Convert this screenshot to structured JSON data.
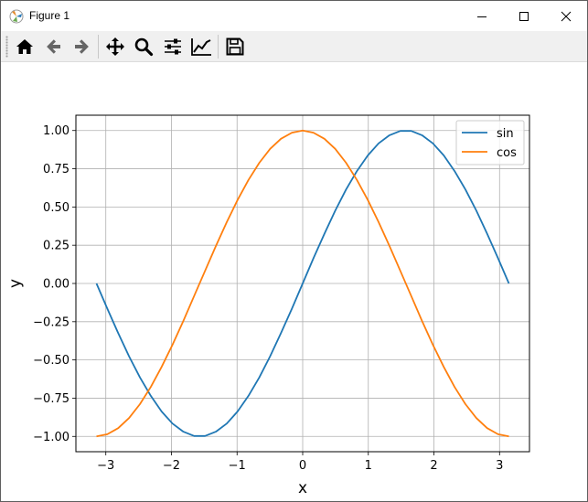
{
  "window": {
    "title": "Figure 1",
    "controls": [
      "minimize",
      "maximize",
      "close"
    ]
  },
  "toolbar": {
    "buttons": [
      {
        "name": "home",
        "icon": "home-icon"
      },
      {
        "name": "back",
        "icon": "arrow-left-icon"
      },
      {
        "name": "forward",
        "icon": "arrow-right-icon"
      },
      {
        "name": "pan",
        "icon": "move-icon"
      },
      {
        "name": "zoom",
        "icon": "magnifier-icon"
      },
      {
        "name": "configure-subplots",
        "icon": "sliders-icon"
      },
      {
        "name": "edit-axis",
        "icon": "line-chart-icon"
      },
      {
        "name": "save",
        "icon": "floppy-disk-icon"
      }
    ]
  },
  "chart_data": {
    "type": "line",
    "xlabel": "x",
    "ylabel": "y",
    "xlim": [
      -3.456,
      3.456
    ],
    "ylim": [
      -1.1,
      1.1
    ],
    "xticks": [
      -3,
      -2,
      -1,
      0,
      1,
      2,
      3
    ],
    "xtick_labels": [
      "−3",
      "−2",
      "−1",
      "0",
      "1",
      "2",
      "3"
    ],
    "yticks": [
      1.0,
      0.75,
      0.5,
      0.25,
      0.0,
      -0.25,
      -0.5,
      -0.75,
      -1.0
    ],
    "ytick_labels": [
      "1.00",
      "0.75",
      "0.50",
      "0.25",
      "0.00",
      "−0.25",
      "−0.50",
      "−0.75",
      "−1.00"
    ],
    "grid": true,
    "legend": {
      "position": "top-right",
      "entries": [
        "sin",
        "cos"
      ]
    },
    "x": [
      -3.142,
      -2.976,
      -2.811,
      -2.646,
      -2.48,
      -2.315,
      -2.15,
      -1.984,
      -1.819,
      -1.654,
      -1.488,
      -1.323,
      -1.157,
      -0.992,
      -0.827,
      -0.661,
      -0.496,
      -0.331,
      -0.165,
      0.0,
      0.165,
      0.331,
      0.496,
      0.661,
      0.827,
      0.992,
      1.157,
      1.323,
      1.488,
      1.654,
      1.819,
      1.984,
      2.15,
      2.315,
      2.48,
      2.646,
      2.811,
      2.976,
      3.142
    ],
    "series": [
      {
        "name": "sin",
        "color": "#1f77b4",
        "values": [
          0.0,
          -0.165,
          -0.325,
          -0.476,
          -0.614,
          -0.735,
          -0.837,
          -0.916,
          -0.969,
          -0.997,
          -0.997,
          -0.969,
          -0.916,
          -0.837,
          -0.735,
          -0.614,
          -0.476,
          -0.325,
          -0.165,
          0.0,
          0.165,
          0.325,
          0.476,
          0.614,
          0.735,
          0.837,
          0.916,
          0.969,
          0.997,
          0.997,
          0.969,
          0.916,
          0.837,
          0.735,
          0.614,
          0.476,
          0.325,
          0.165,
          0.0
        ]
      },
      {
        "name": "cos",
        "color": "#ff7f0e",
        "values": [
          -1.0,
          -0.986,
          -0.946,
          -0.88,
          -0.789,
          -0.677,
          -0.546,
          -0.401,
          -0.245,
          -0.082,
          0.082,
          0.245,
          0.401,
          0.546,
          0.677,
          0.789,
          0.88,
          0.946,
          0.986,
          1.0,
          0.986,
          0.946,
          0.88,
          0.789,
          0.677,
          0.546,
          0.401,
          0.245,
          0.082,
          -0.082,
          -0.245,
          -0.401,
          -0.546,
          -0.677,
          -0.789,
          -0.88,
          -0.946,
          -0.986,
          -1.0
        ]
      }
    ]
  }
}
